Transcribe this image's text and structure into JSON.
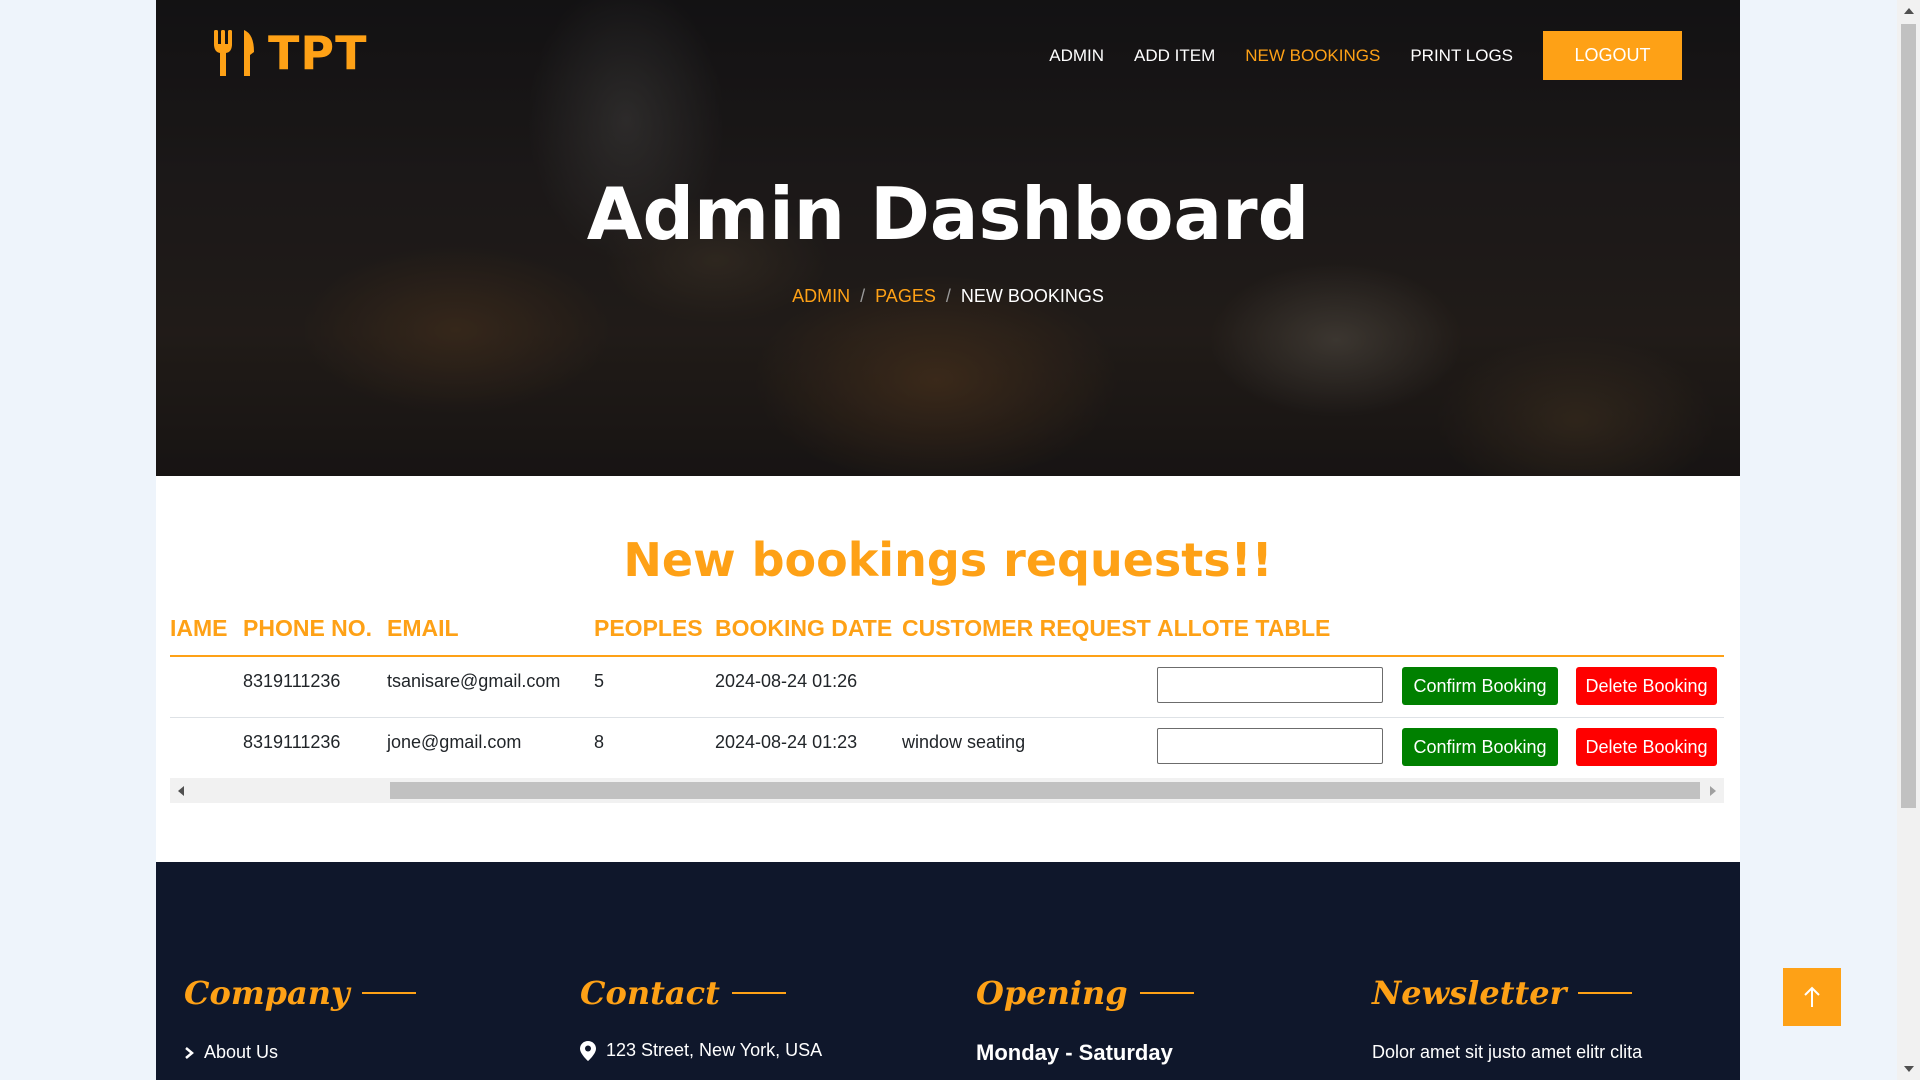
{
  "brand": {
    "name": "TPT",
    "icon": "utensils-icon",
    "accent_color": "#fea116"
  },
  "nav": {
    "items": [
      {
        "label": "ADMIN",
        "active": false
      },
      {
        "label": "ADD ITEM",
        "active": false
      },
      {
        "label": "NEW BOOKINGS",
        "active": true
      },
      {
        "label": "PRINT LOGS",
        "active": false
      }
    ],
    "logout_label": "LOGOUT"
  },
  "hero": {
    "title": "Admin Dashboard",
    "breadcrumb": [
      "ADMIN",
      "PAGES",
      "NEW BOOKINGS"
    ],
    "breadcrumb_separator": "/"
  },
  "bookings": {
    "title": "New bookings requests!!",
    "columns": [
      "NAME",
      "PHONE NO.",
      "EMAIL",
      "PEOPLES",
      "BOOKING DATE",
      "CUSTOMER REQUEST",
      "ALLOTE TABLE"
    ],
    "visible_first_column_fragment": "IAME",
    "rows": [
      {
        "phone": "8319111236",
        "email": "tsanisare@gmail.com",
        "peoples": "5",
        "booking_date": "2024-08-24 01:26",
        "request": "",
        "table_input": ""
      },
      {
        "phone": "8319111236",
        "email": "jone@gmail.com",
        "peoples": "8",
        "booking_date": "2024-08-24 01:23",
        "request": "window seating",
        "table_input": ""
      }
    ],
    "confirm_label": "Confirm Booking",
    "delete_label": "Delete Booking",
    "confirm_color": "#008000",
    "delete_color": "#ff0000"
  },
  "footer": {
    "background": "#0f172b",
    "columns": [
      {
        "heading": "Company",
        "first_item": "About Us",
        "icon": "chevron-right-icon"
      },
      {
        "heading": "Contact",
        "first_item": "123 Street, New York, USA",
        "icon": "map-marker-icon"
      },
      {
        "heading": "Opening",
        "first_item": "Monday - Saturday",
        "icon": ""
      },
      {
        "heading": "Newsletter",
        "first_item": "Dolor amet sit justo amet elitr clita",
        "icon": ""
      }
    ]
  },
  "back_to_top": {
    "icon": "arrow-up-icon"
  }
}
